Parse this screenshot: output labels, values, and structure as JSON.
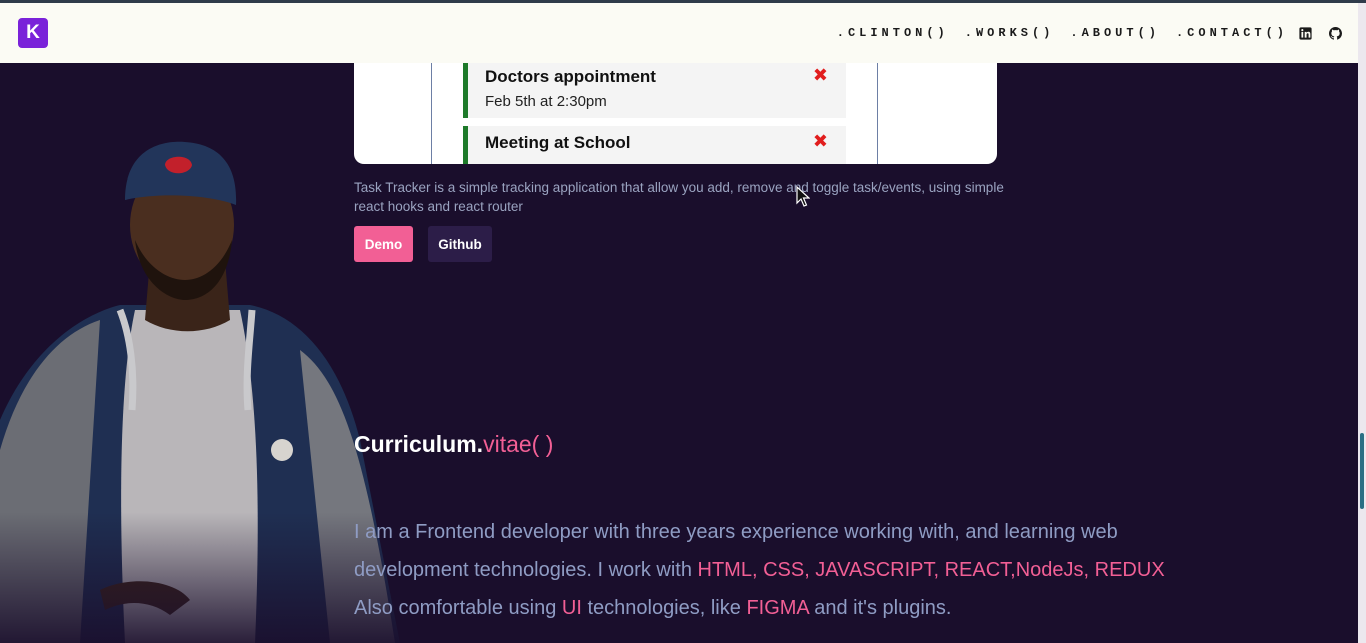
{
  "nav": {
    "logo": "K",
    "links": [
      ".CLINTON()",
      ".WORKS()",
      ".ABOUT()",
      ".CONTACT()"
    ],
    "icons": [
      "linkedin-icon",
      "github-icon"
    ]
  },
  "project": {
    "tasks": [
      {
        "title": "Doctors appointment",
        "date": "Feb 5th at 2:30pm",
        "delete": "✖"
      },
      {
        "title": "Meeting at School",
        "date": "",
        "delete": "✖"
      }
    ],
    "description": "Task Tracker is a simple tracking application that allow you add, remove and toggle task/events, using simple react hooks and react router",
    "demo_label": "Demo",
    "github_label": "Github"
  },
  "cv": {
    "title_main": "Curriculum.",
    "title_accent": "vitae( )",
    "about_parts": {
      "p1": "I am a Frontend developer with three years experience working with, and learning web development technologies. I work with ",
      "h1": "HTML, CSS, JAVASCRIPT, REACT,NodeJs, REDUX",
      "p2": " Also comfortable using ",
      "h2": "UI",
      "p3": " technologies, like ",
      "h3": "FIGMA",
      "p4": " and it's plugins."
    }
  },
  "colors": {
    "background": "#1a0e2c",
    "accent": "#f25f95",
    "logo": "#7a22d9",
    "navbar": "#fbfbf4",
    "text_muted": "#8f9cc4"
  }
}
